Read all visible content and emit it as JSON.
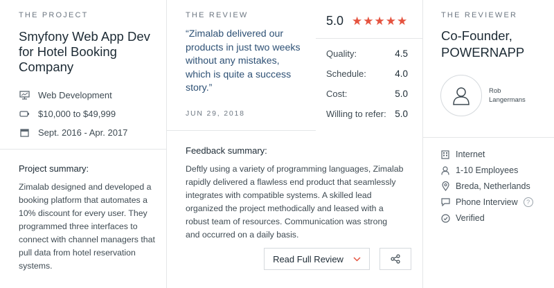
{
  "project": {
    "eyebrow": "THE PROJECT",
    "title": "Smyfony Web App Dev for Hotel Booking Company",
    "meta": [
      {
        "icon": "monitor-icon",
        "text": "Web Development"
      },
      {
        "icon": "price-tag-icon",
        "text": "$10,000 to $49,999"
      },
      {
        "icon": "calendar-icon",
        "text": "Sept. 2016 - Apr. 2017"
      }
    ],
    "summary_label": "Project summary:",
    "summary_text": "Zimalab designed and developed a booking platform that automates a 10% discount for every user. They programmed three interfaces to connect with channel managers that pull data from hotel reservation systems."
  },
  "review": {
    "eyebrow": "THE REVIEW",
    "quote": "“Zimalab delivered our products in just two weeks without any mistakes, which is quite a success story.”",
    "date": "JUN 29, 2018",
    "overall": "5.0",
    "stars": 5,
    "scores": [
      {
        "label": "Quality:",
        "value": "4.5"
      },
      {
        "label": "Schedule:",
        "value": "4.0"
      },
      {
        "label": "Cost:",
        "value": "5.0"
      },
      {
        "label": "Willing to refer:",
        "value": "5.0"
      }
    ],
    "feedback_label": "Feedback summary:",
    "feedback_text": "Deftly using a variety of programming languages, Zimalab rapidly delivered a flawless end product that seamlessly integrates with compatible systems. A skilled lead organized the project methodically and leased with a robust team of resources. Communication was strong and occurred on a daily basis.",
    "read_full_label": "Read Full Review"
  },
  "reviewer": {
    "eyebrow": "THE REVIEWER",
    "title": "Co-Founder, POWERNAPP",
    "name_line1": "Rob",
    "name_line2": "Langermans",
    "info": [
      {
        "icon": "building-icon",
        "text": "Internet"
      },
      {
        "icon": "user-icon",
        "text": "1-10 Employees"
      },
      {
        "icon": "location-pin-icon",
        "text": "Breda, Netherlands"
      },
      {
        "icon": "chat-bubble-icon",
        "text": "Phone Interview"
      },
      {
        "icon": "check-circle-icon",
        "text": "Verified"
      }
    ]
  },
  "colors": {
    "star": "#e5533f",
    "quote": "#2e5175",
    "accent": "#e5533f"
  }
}
